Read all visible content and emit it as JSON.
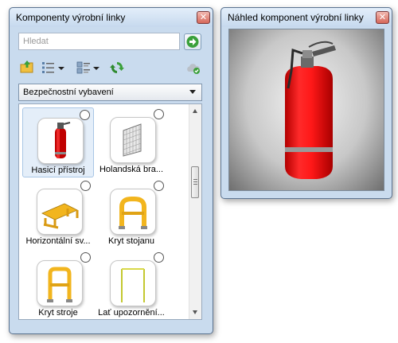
{
  "left_window": {
    "title": "Komponenty výrobní linky",
    "search_placeholder": "Hledat",
    "category_selected": "Bezpečnostní vybavení",
    "items": [
      {
        "label": "Hasicí přístroj",
        "icon": "fire-extinguisher-icon"
      },
      {
        "label": "Holandská bra...",
        "icon": "mesh-gate-icon"
      },
      {
        "label": "Horizontální sv...",
        "icon": "horizontal-rail-icon"
      },
      {
        "label": "Kryt stojanu",
        "icon": "rack-guard-icon"
      },
      {
        "label": "Kryt stroje",
        "icon": "machine-guard-icon"
      },
      {
        "label": "Lať upozornění...",
        "icon": "warning-bar-icon"
      }
    ]
  },
  "right_window": {
    "title": "Náhled komponent výrobní linky",
    "preview": "fire-extinguisher"
  },
  "colors": {
    "accent_green": "#3aa03a",
    "extinguisher_red": "#e01010",
    "guard_yellow": "#f2b51e"
  }
}
